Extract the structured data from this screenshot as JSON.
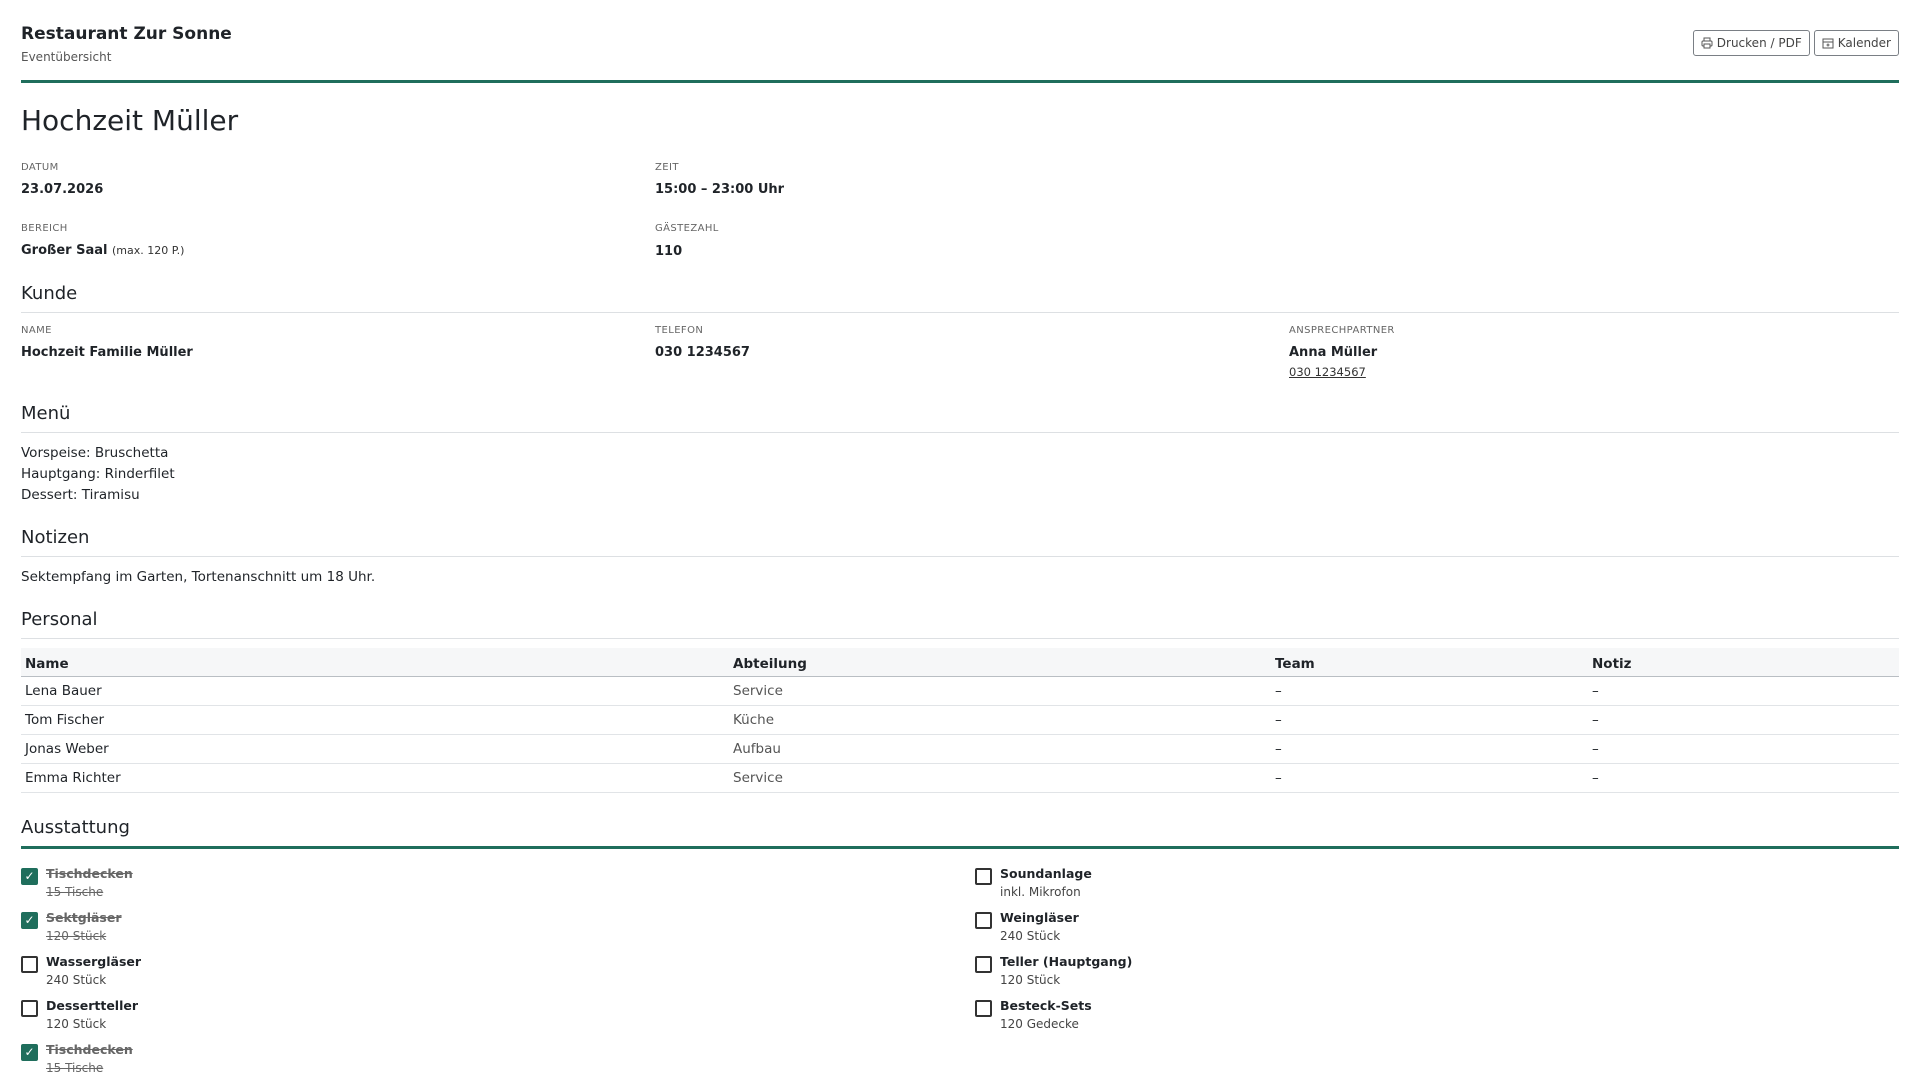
{
  "header": {
    "title": "Restaurant Zur Sonne",
    "subtitle": "Eventübersicht",
    "print_label": "Drucken / PDF",
    "calendar_label": "Kalender"
  },
  "event": {
    "title": "Hochzeit Müller",
    "date_label": "DATUM",
    "date": "23.07.2026",
    "time_label": "ZEIT",
    "time": "15:00 – 23:00 Uhr",
    "area_label": "BEREICH",
    "area": "Großer Saal",
    "area_hint": "(max. 120 P.)",
    "guests_label": "GÄSTEZAHL",
    "guests": "110"
  },
  "customer": {
    "section": "Kunde",
    "name_label": "NAME",
    "name": "Hochzeit Familie Müller",
    "phone_label": "TELEFON",
    "phone": "030 1234567",
    "contact_label": "ANSPRECHPARTNER",
    "contact_name": "Anna Müller",
    "contact_phone": "030 1234567"
  },
  "menu": {
    "section": "Menü",
    "lines": [
      "Vorspeise: Bruschetta",
      "Hauptgang: Rinderfilet",
      "Dessert: Tiramisu"
    ]
  },
  "notes": {
    "section": "Notizen",
    "text": "Sektempfang im Garten, Tortenanschnitt um 18 Uhr."
  },
  "staff": {
    "section": "Personal",
    "headers": [
      "Name",
      "Abteilung",
      "Team",
      "Notiz"
    ],
    "rows": [
      [
        "Lena Bauer",
        "Service",
        "–",
        "–"
      ],
      [
        "Tom Fischer",
        "Küche",
        "–",
        "–"
      ],
      [
        "Jonas Weber",
        "Aufbau",
        "–",
        "–"
      ],
      [
        "Emma Richter",
        "Service",
        "–",
        "–"
      ]
    ]
  },
  "equipment": {
    "section": "Ausstattung",
    "left": [
      {
        "name": "Tischdecken",
        "detail": "15 Tische",
        "checked": true
      },
      {
        "name": "Sektgläser",
        "detail": "120 Stück",
        "checked": true
      },
      {
        "name": "Wassergläser",
        "detail": "240 Stück",
        "checked": false
      },
      {
        "name": "Dessertteller",
        "detail": "120 Stück",
        "checked": false
      },
      {
        "name": "Tischdecken",
        "detail": "15 Tische",
        "checked": true
      }
    ],
    "right": [
      {
        "name": "Soundanlage",
        "detail": "inkl. Mikrofon",
        "checked": false
      },
      {
        "name": "Weingläser",
        "detail": "240 Stück",
        "checked": false
      },
      {
        "name": "Teller (Hauptgang)",
        "detail": "120 Stück",
        "checked": false
      },
      {
        "name": "Besteck-Sets",
        "detail": "120 Gedecke",
        "checked": false
      }
    ]
  },
  "colors": {
    "accent": "#1f6e5c"
  },
  "icons": {
    "print": "printer-icon",
    "calendar": "calendar-icon",
    "check": "check-icon"
  }
}
